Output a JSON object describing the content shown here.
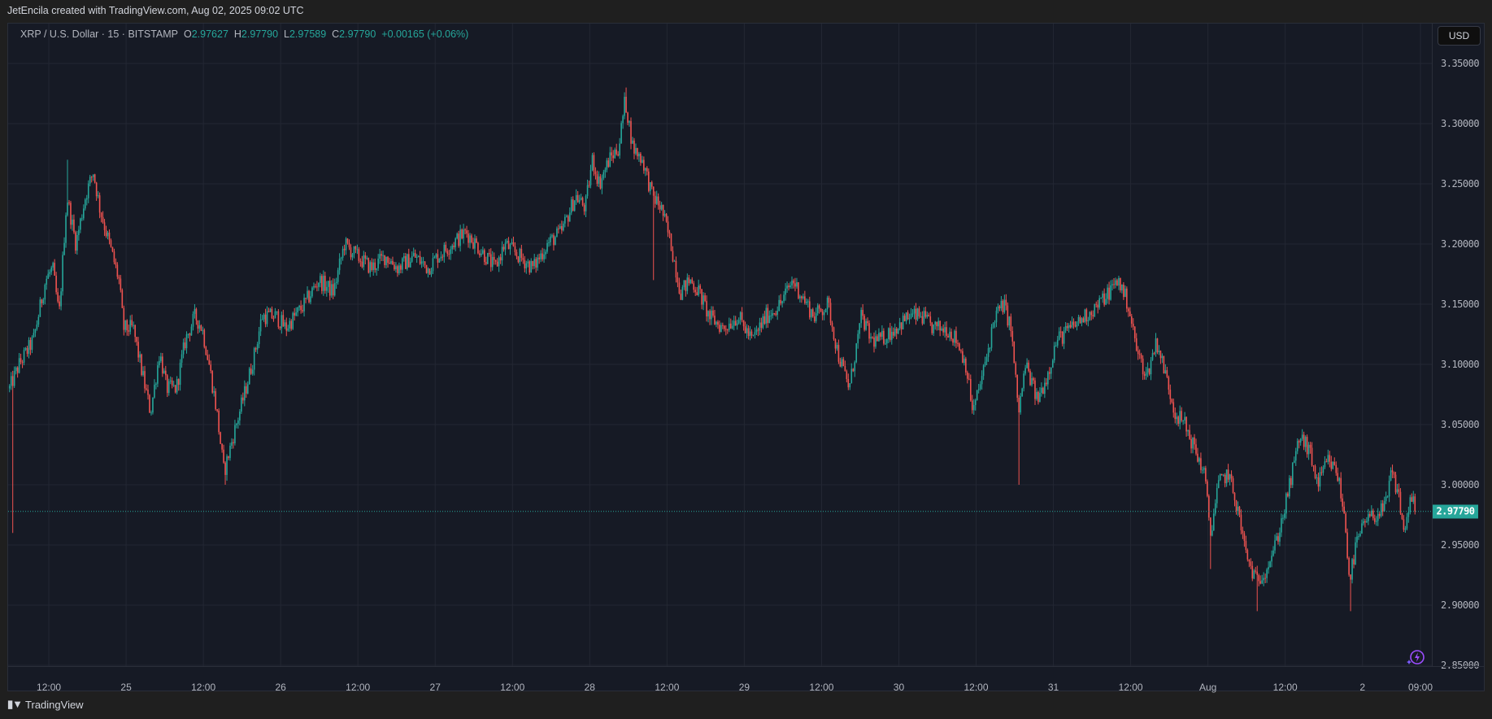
{
  "credit": "JetEncila created with TradingView.com, Aug 02, 2025 09:02 UTC",
  "legend": {
    "symbol": "XRP / U.S. Dollar · 15 · BITSTAMP",
    "o_label": "O",
    "o": "2.97627",
    "h_label": "H",
    "h": "2.97790",
    "l_label": "L",
    "l": "2.97589",
    "c_label": "C",
    "c": "2.97790",
    "change": "+0.00165 (+0.06%)"
  },
  "currency_button": "USD",
  "last_price": "2.97790",
  "footer_brand": "TradingView",
  "footer_logo": "TV",
  "colors": {
    "up": "#26a69a",
    "down": "#ef5350",
    "grid": "#232733",
    "bg": "#161a25",
    "ai_icon": "#9c4dff"
  },
  "chart_data": {
    "type": "candlestick",
    "interval_minutes": 15,
    "time_unit": "hours since Jul 24 00:00 UTC",
    "ylim": [
      2.85,
      3.35
    ],
    "last": 2.9779,
    "price_ticks": [
      "3.35000",
      "3.30000",
      "3.25000",
      "3.20000",
      "3.15000",
      "3.10000",
      "3.05000",
      "3.00000",
      "2.95000",
      "2.90000",
      "2.85000"
    ],
    "time_ticks": [
      {
        "label": "12:00",
        "t": 12
      },
      {
        "label": "25",
        "t": 24
      },
      {
        "label": "12:00",
        "t": 36
      },
      {
        "label": "26",
        "t": 48
      },
      {
        "label": "12:00",
        "t": 60
      },
      {
        "label": "27",
        "t": 72
      },
      {
        "label": "12:00",
        "t": 84
      },
      {
        "label": "28",
        "t": 96
      },
      {
        "label": "12:00",
        "t": 108
      },
      {
        "label": "29",
        "t": 120
      },
      {
        "label": "12:00",
        "t": 132
      },
      {
        "label": "30",
        "t": 144
      },
      {
        "label": "12:00",
        "t": 156
      },
      {
        "label": "31",
        "t": 168
      },
      {
        "label": "12:00",
        "t": 180
      },
      {
        "label": "Aug",
        "t": 192
      },
      {
        "label": "12:00",
        "t": 204
      },
      {
        "label": "2",
        "t": 216
      },
      {
        "label": "09:00",
        "t": 225
      }
    ],
    "price_path": [
      [
        5.9,
        3.08
      ],
      [
        7.4,
        3.1
      ],
      [
        9.6,
        3.12
      ],
      [
        11.5,
        3.17
      ],
      [
        12.6,
        3.18
      ],
      [
        13.6,
        3.14
      ],
      [
        14.8,
        3.24
      ],
      [
        16.2,
        3.2
      ],
      [
        17.7,
        3.24
      ],
      [
        18.9,
        3.26
      ],
      [
        19.9,
        3.23
      ],
      [
        21.4,
        3.2
      ],
      [
        22.9,
        3.17
      ],
      [
        23.6,
        3.13
      ],
      [
        25.1,
        3.13
      ],
      [
        26.6,
        3.09
      ],
      [
        27.8,
        3.06
      ],
      [
        29.2,
        3.11
      ],
      [
        30.3,
        3.08
      ],
      [
        31.8,
        3.08
      ],
      [
        33.2,
        3.12
      ],
      [
        34.7,
        3.14
      ],
      [
        35.8,
        3.13
      ],
      [
        36.9,
        3.1
      ],
      [
        38.1,
        3.06
      ],
      [
        39.2,
        3.01
      ],
      [
        40.6,
        3.04
      ],
      [
        42.6,
        3.08
      ],
      [
        44.0,
        3.11
      ],
      [
        45.1,
        3.14
      ],
      [
        47.3,
        3.14
      ],
      [
        48.8,
        3.13
      ],
      [
        50.2,
        3.14
      ],
      [
        51.7,
        3.15
      ],
      [
        53.9,
        3.17
      ],
      [
        56.2,
        3.16
      ],
      [
        57.9,
        3.2
      ],
      [
        59.8,
        3.19
      ],
      [
        62.1,
        3.18
      ],
      [
        64.3,
        3.19
      ],
      [
        66.2,
        3.18
      ],
      [
        68.7,
        3.19
      ],
      [
        70.9,
        3.18
      ],
      [
        72.4,
        3.19
      ],
      [
        74.6,
        3.2
      ],
      [
        76.8,
        3.21
      ],
      [
        78.3,
        3.2
      ],
      [
        79.8,
        3.19
      ],
      [
        81.3,
        3.18
      ],
      [
        82.8,
        3.2
      ],
      [
        85.0,
        3.19
      ],
      [
        87.2,
        3.18
      ],
      [
        89.4,
        3.2
      ],
      [
        91.6,
        3.21
      ],
      [
        93.8,
        3.24
      ],
      [
        95.3,
        3.23
      ],
      [
        96.4,
        3.27
      ],
      [
        97.5,
        3.25
      ],
      [
        99.0,
        3.27
      ],
      [
        100.5,
        3.28
      ],
      [
        101.5,
        3.32
      ],
      [
        102.7,
        3.28
      ],
      [
        104.2,
        3.27
      ],
      [
        105.7,
        3.24
      ],
      [
        107.1,
        3.23
      ],
      [
        108.6,
        3.2
      ],
      [
        110.1,
        3.16
      ],
      [
        111.6,
        3.17
      ],
      [
        113.0,
        3.16
      ],
      [
        114.5,
        3.14
      ],
      [
        116.7,
        3.13
      ],
      [
        119.0,
        3.14
      ],
      [
        121.2,
        3.12
      ],
      [
        123.4,
        3.14
      ],
      [
        125.6,
        3.15
      ],
      [
        127.5,
        3.17
      ],
      [
        128.6,
        3.16
      ],
      [
        130.8,
        3.14
      ],
      [
        133.0,
        3.15
      ],
      [
        134.5,
        3.11
      ],
      [
        136.3,
        3.08
      ],
      [
        138.2,
        3.14
      ],
      [
        139.7,
        3.12
      ],
      [
        141.1,
        3.12
      ],
      [
        143.4,
        3.13
      ],
      [
        145.6,
        3.14
      ],
      [
        147.5,
        3.14
      ],
      [
        149.3,
        3.13
      ],
      [
        151.5,
        3.13
      ],
      [
        153.0,
        3.12
      ],
      [
        154.4,
        3.1
      ],
      [
        155.5,
        3.06
      ],
      [
        157.4,
        3.1
      ],
      [
        158.9,
        3.14
      ],
      [
        160.3,
        3.15
      ],
      [
        161.4,
        3.13
      ],
      [
        162.6,
        3.06
      ],
      [
        163.7,
        3.1
      ],
      [
        165.5,
        3.07
      ],
      [
        167.0,
        3.09
      ],
      [
        168.5,
        3.12
      ],
      [
        170.7,
        3.13
      ],
      [
        172.9,
        3.14
      ],
      [
        175.1,
        3.15
      ],
      [
        176.6,
        3.16
      ],
      [
        178.1,
        3.17
      ],
      [
        179.6,
        3.15
      ],
      [
        181.0,
        3.11
      ],
      [
        182.5,
        3.09
      ],
      [
        184.0,
        3.12
      ],
      [
        185.5,
        3.09
      ],
      [
        186.9,
        3.06
      ],
      [
        188.4,
        3.05
      ],
      [
        189.9,
        3.03
      ],
      [
        191.4,
        3.01
      ],
      [
        192.4,
        2.96
      ],
      [
        193.6,
        3.0
      ],
      [
        195.1,
        3.01
      ],
      [
        196.6,
        2.98
      ],
      [
        198.0,
        2.94
      ],
      [
        199.5,
        2.92
      ],
      [
        201.0,
        2.93
      ],
      [
        202.5,
        2.95
      ],
      [
        203.9,
        2.98
      ],
      [
        205.1,
        3.01
      ],
      [
        206.2,
        3.04
      ],
      [
        207.6,
        3.03
      ],
      [
        209.1,
        3.0
      ],
      [
        210.6,
        3.02
      ],
      [
        212.1,
        3.01
      ],
      [
        213.3,
        2.97
      ],
      [
        214.0,
        2.92
      ],
      [
        215.0,
        2.95
      ],
      [
        216.5,
        2.97
      ],
      [
        218.0,
        2.975
      ],
      [
        219.5,
        2.98
      ],
      [
        220.5,
        3.01
      ],
      [
        221.7,
        2.99
      ],
      [
        222.4,
        2.96
      ],
      [
        223.5,
        2.99
      ],
      [
        224.3,
        2.9779
      ]
    ],
    "wick_extremes": [
      {
        "t": 6.5,
        "low": 2.96
      },
      {
        "t": 15.0,
        "high": 3.27
      },
      {
        "t": 39.4,
        "low": 3.0
      },
      {
        "t": 101.7,
        "high": 3.33
      },
      {
        "t": 105.9,
        "low": 3.17
      },
      {
        "t": 162.7,
        "low": 3.0
      },
      {
        "t": 192.5,
        "low": 2.93
      },
      {
        "t": 199.6,
        "low": 2.895
      },
      {
        "t": 214.1,
        "low": 2.895
      }
    ]
  }
}
